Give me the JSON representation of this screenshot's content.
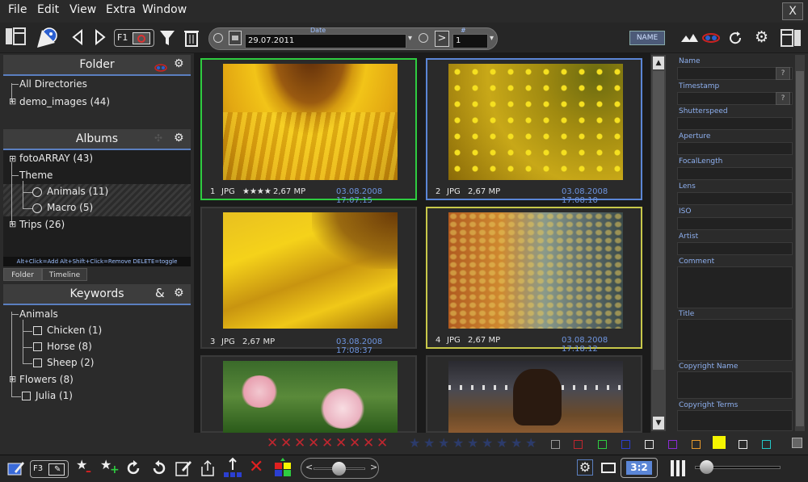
{
  "menu": [
    "File",
    "Edit",
    "View",
    "Extra",
    "Window"
  ],
  "window": {
    "close_label": "X"
  },
  "toolbar": {
    "f1_label": "F1",
    "date_label": "Date",
    "date_value": "29.07.2011",
    "next_label": ">",
    "count_label": "#",
    "count_value": "1",
    "sort_label": "NAME"
  },
  "panels": {
    "folder": {
      "title": "Folder",
      "items": [
        "All Directories",
        "demo_images (44)"
      ]
    },
    "albums": {
      "title": "Albums",
      "items": [
        "fotoARRAY (43)",
        "Theme",
        "Animals (11)",
        "Macro (5)",
        "Trips (26)"
      ],
      "hint": "Alt+Click=Add  Alt+Shift+Click=Remove  DELETE=toggle"
    },
    "tabs": [
      "Folder",
      "Timeline"
    ],
    "keywords": {
      "title": "Keywords",
      "amp": "&",
      "items": [
        "Animals",
        "Chicken (1)",
        "Horse (8)",
        "Sheep (2)",
        "Flowers (8)",
        "Julia (1)"
      ]
    }
  },
  "photos": [
    {
      "index": "1",
      "type": "JPG",
      "rating": "★★★★",
      "size": "2,67 MP",
      "date": "03.08.2008 17:07:15",
      "border": "#2ecc40"
    },
    {
      "index": "2",
      "type": "JPG",
      "rating": "",
      "size": "2,67 MP",
      "date": "03.08.2008 17:08:10",
      "border": "#5b86d6"
    },
    {
      "index": "3",
      "type": "JPG",
      "rating": "",
      "size": "2,67 MP",
      "date": "03.08.2008 17:08:37",
      "border": "#3a3a3a"
    },
    {
      "index": "4",
      "type": "JPG",
      "rating": "",
      "size": "2,67 MP",
      "date": "03.08.2008 17:18:12",
      "border": "#c8c84a"
    }
  ],
  "info_fields": [
    "Name",
    "Timestamp",
    "Shutterspeed",
    "Aperture",
    "FocalLength",
    "Lens",
    "ISO",
    "Artist",
    "Comment",
    "Title",
    "Copyright Name",
    "Copyright Terms"
  ],
  "info_help": "?",
  "filter_colors": [
    "#2b2b2b",
    "#c0262f",
    "#2ecc40",
    "#2b3fd1",
    "#e8e8e8",
    "#8c2bd6",
    "#e89a2b",
    "#f5f500",
    "#e8e8e8",
    "#22c8c8"
  ],
  "bottom": {
    "f3_label": "F3",
    "ratio_label": "3:2",
    "prev_label": "<",
    "next_label": ">"
  }
}
